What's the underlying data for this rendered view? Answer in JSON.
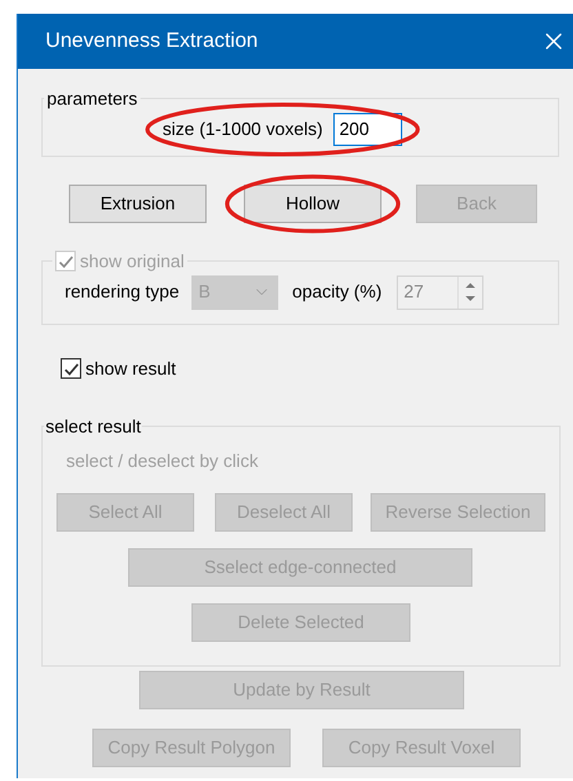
{
  "window": {
    "title": "Unevenness Extraction"
  },
  "parameters": {
    "legend": "parameters",
    "size_label": "size (1-1000 voxels)",
    "size_value": "200",
    "highlighted": true
  },
  "actions": [
    {
      "label": "Extrusion",
      "disabled": false,
      "highlighted": false
    },
    {
      "label": "Hollow",
      "disabled": false,
      "highlighted": true
    },
    {
      "label": "Back",
      "disabled": true,
      "highlighted": false
    }
  ],
  "show_original": {
    "label": "show original",
    "checked": true,
    "disabled": true,
    "rendering_label": "rendering type",
    "rendering_value": "B",
    "opacity_label": "opacity (%)",
    "opacity_value": "27"
  },
  "show_result": {
    "label": "show result",
    "checked": true,
    "disabled": false
  },
  "select_result": {
    "legend": "select result",
    "hint": "select / deselect by click",
    "rows": [
      {
        "buttons": [
          {
            "label": "Select All",
            "disabled": true
          },
          {
            "label": "Deselect All",
            "disabled": true
          },
          {
            "label": "Reverse Selection",
            "disabled": true
          }
        ]
      },
      {
        "buttons": [
          {
            "label": "Sselect edge-connected",
            "disabled": true
          }
        ]
      },
      {
        "buttons": [
          {
            "label": "Delete Selected",
            "disabled": true
          }
        ]
      }
    ]
  },
  "bottom_rows": [
    {
      "buttons": [
        {
          "label": "Update by Result",
          "disabled": true
        }
      ]
    },
    {
      "buttons": [
        {
          "label": "Copy Result Polygon",
          "disabled": true
        },
        {
          "label": "Copy Result Voxel",
          "disabled": true
        }
      ]
    }
  ]
}
